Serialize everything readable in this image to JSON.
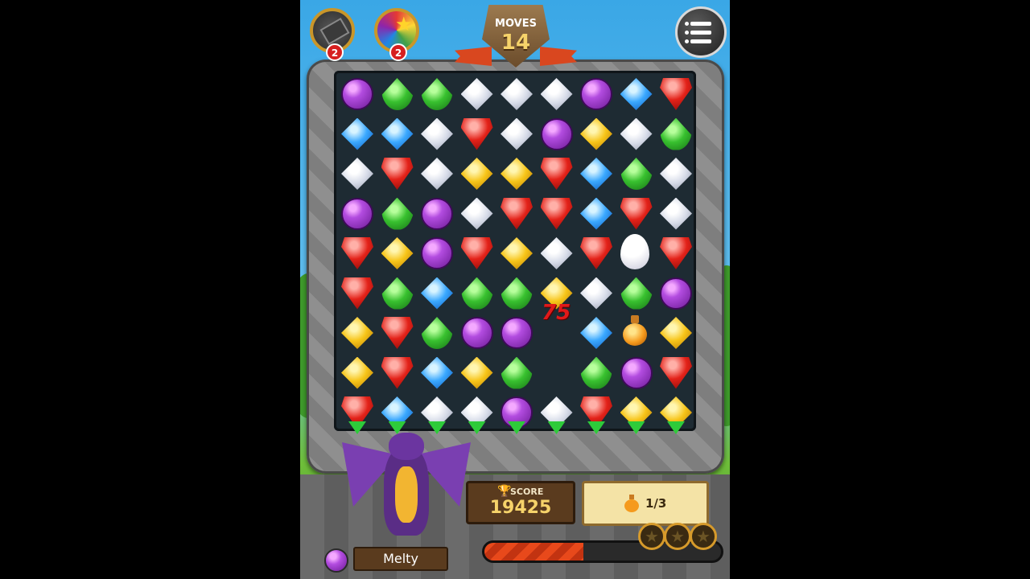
{
  "hud": {
    "moves_label": "MOVES",
    "moves_value": "14",
    "booster_hammer_count": "2",
    "booster_rainbow_count": "2"
  },
  "board": {
    "floating_points": "75",
    "grid": [
      [
        "purple",
        "green",
        "green",
        "white",
        "white",
        "white",
        "purple",
        "blue",
        "red"
      ],
      [
        "blue",
        "blue",
        "white",
        "red",
        "white",
        "purple",
        "yellow",
        "white",
        "green"
      ],
      [
        "white",
        "red",
        "white",
        "yellow",
        "yellow",
        "red",
        "blue",
        "green",
        "white"
      ],
      [
        "purple",
        "green",
        "purple",
        "white",
        "red",
        "red",
        "blue",
        "red",
        "white"
      ],
      [
        "red",
        "yellow",
        "purple",
        "red",
        "yellow",
        "white",
        "red",
        "egg",
        "red"
      ],
      [
        "red",
        "green",
        "blue",
        "green",
        "green",
        "yellow",
        "white",
        "green",
        "purple"
      ],
      [
        "yellow",
        "red",
        "green",
        "purple",
        "purple",
        "empty",
        "blue",
        "potion",
        "yellow"
      ],
      [
        "yellow",
        "red",
        "blue",
        "yellow",
        "green",
        "empty",
        "green",
        "purple",
        "red"
      ],
      [
        "red",
        "blue",
        "white",
        "white",
        "purple",
        "white",
        "red",
        "yellow",
        "yellow"
      ]
    ]
  },
  "score": {
    "label": "SCORE",
    "value": "19425"
  },
  "goal": {
    "icon": "potion-icon",
    "progress_text": "1/3"
  },
  "character": {
    "name": "Melty"
  },
  "progress_bar": {
    "fill_fraction": 0.42
  },
  "stars": {
    "earned": 0,
    "total": 3
  }
}
